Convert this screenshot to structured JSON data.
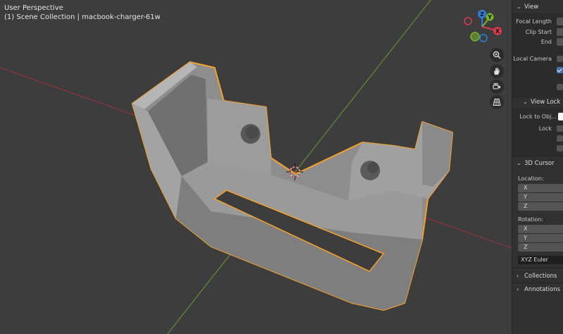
{
  "viewport": {
    "view_name": "User Perspective",
    "collection_info": "(1) Scene Collection | macbook-charger-61w"
  },
  "gizmo": {
    "z_label": "Z",
    "y_label": "Y",
    "x_label": "X",
    "colors": {
      "x": "#d8394e",
      "y": "#77b62c",
      "z": "#2f7fd8"
    }
  },
  "nav_buttons": [
    {
      "icon": "zoom-icon"
    },
    {
      "icon": "hand-pan-icon"
    },
    {
      "icon": "camera-icon"
    },
    {
      "icon": "grid-ortho-icon"
    }
  ],
  "sidebar": {
    "view_header": "View",
    "focal_length_label": "Focal Length",
    "clip_start_label": "Clip Start",
    "end_label": "End",
    "local_camera_label": "Local Camera",
    "view_lock_header": "View Lock",
    "lock_to_object_label": "Lock to Obj...",
    "lock_label": "Lock",
    "cursor_header": "3D Cursor",
    "location_label": "Location:",
    "rotation_label": "Rotation:",
    "axis_x": "X",
    "axis_y": "Y",
    "axis_z": "Z",
    "rotation_mode": "XYZ Euler",
    "collections_header": "Collections",
    "annotations_header": "Annotations"
  },
  "colors": {
    "viewport_bg": "#3d3d3d",
    "selection_outline": "#f5a12a",
    "x_axis_line": "#b0323f",
    "y_axis_line": "#6d9a2c",
    "checkbox_on": "#4772b3"
  }
}
